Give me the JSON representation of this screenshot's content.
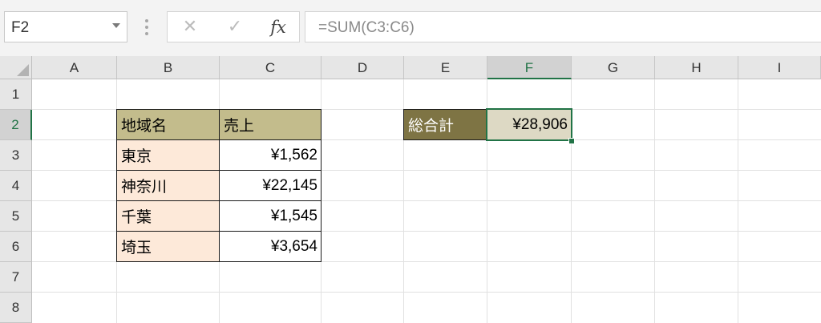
{
  "name_box": {
    "value": "F2"
  },
  "formula_bar": {
    "cancel_glyph": "✕",
    "enter_glyph": "✓",
    "fx_label": "fx",
    "formula": "=SUM(C3:C6)"
  },
  "columns": [
    "A",
    "B",
    "C",
    "D",
    "E",
    "F",
    "G",
    "H",
    "I"
  ],
  "rows": [
    "1",
    "2",
    "3",
    "4",
    "5",
    "6",
    "7",
    "8"
  ],
  "active_cell": {
    "column": "F",
    "row": "2"
  },
  "table": {
    "header_region": "地域名",
    "header_sales": "売上",
    "rows": [
      {
        "region": "東京",
        "sales": "¥1,562"
      },
      {
        "region": "神奈川",
        "sales": "¥22,145"
      },
      {
        "region": "千葉",
        "sales": "¥1,545"
      },
      {
        "region": "埼玉",
        "sales": "¥3,654"
      }
    ]
  },
  "total": {
    "label": "総合計",
    "value": "¥28,906"
  },
  "colors": {
    "accent": "#217346",
    "header_fill": "#c3bc8c",
    "region_fill": "#fde9d9",
    "total_label_fill": "#7e7444",
    "total_value_fill": "#ddd9c4"
  }
}
